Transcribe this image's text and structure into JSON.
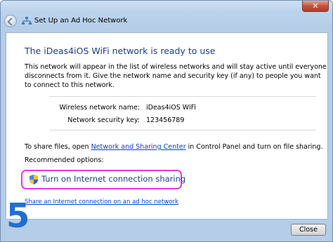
{
  "window": {
    "title": "Set Up an Ad Hoc Network"
  },
  "content": {
    "heading": "The iDeas4iOS WiFi network is ready to use",
    "paragraph_lines": [
      "This network will appear in the list of wireless networks and will stay active until everyone",
      "disconnects from it. Give the network name and security key (if any) to people you want",
      "to connect to this network."
    ],
    "network_name_label": "Wireless network name:",
    "network_name_value": "iDeas4iOS WiFi",
    "security_key_label": "Network security key:",
    "security_key_value": "123456789",
    "share_prefix": "To share files, open ",
    "share_link": "Network and Sharing Center",
    "share_suffix": " in Control Panel and turn on file sharing.",
    "recommended_label": "Recommended options:",
    "ics_option": "Turn on Internet connection sharing",
    "adhoc_link": "Share an Internet connection on an ad hoc network"
  },
  "overlay": {
    "step_number": "5"
  },
  "buttons": {
    "close": "Close"
  },
  "icons": {
    "back": "back-arrow-icon",
    "network": "network-icon",
    "shield": "uac-shield-icon",
    "window_close": "close-icon"
  },
  "colors": {
    "heading": "#1e3f8a",
    "link": "#0044cc",
    "highlight": "#e63be0",
    "step_number": "#1f6fd1"
  }
}
